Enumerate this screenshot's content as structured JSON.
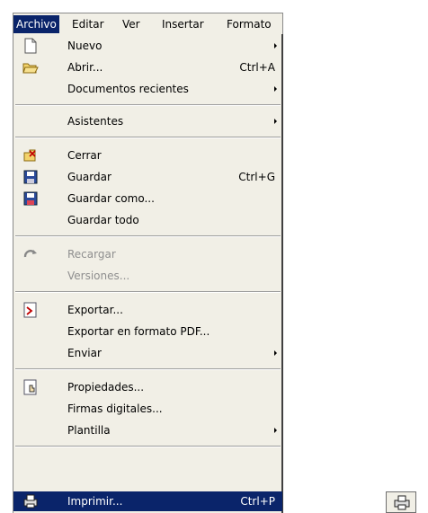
{
  "menubar": {
    "items": [
      {
        "label": "Archivo"
      },
      {
        "label": "Editar"
      },
      {
        "label": "Ver"
      },
      {
        "label": "Insertar"
      },
      {
        "label": "Formato"
      }
    ]
  },
  "menu": {
    "items": [
      {
        "label": "Nuevo",
        "icon": "new-document-icon"
      },
      {
        "label": "Abrir...",
        "shortcut": "Ctrl+A",
        "icon": "open-folder-icon"
      },
      {
        "label": "Documentos recientes"
      },
      {
        "label": "Asistentes"
      },
      {
        "label": "Cerrar",
        "icon": "close-document-icon"
      },
      {
        "label": "Guardar",
        "shortcut": "Ctrl+G",
        "icon": "save-icon"
      },
      {
        "label": "Guardar como...",
        "icon": "save-as-icon"
      },
      {
        "label": "Guardar todo"
      },
      {
        "label": "Recargar",
        "icon": "reload-icon"
      },
      {
        "label": "Versiones..."
      },
      {
        "label": "Exportar...",
        "icon": "export-icon"
      },
      {
        "label": "Exportar en formato PDF..."
      },
      {
        "label": "Enviar"
      },
      {
        "label": "Propiedades...",
        "icon": "properties-icon"
      },
      {
        "label": "Firmas digitales..."
      },
      {
        "label": "Plantilla"
      },
      {
        "label": "Imprimir...",
        "shortcut": "Ctrl+P",
        "icon": "print-icon"
      }
    ]
  },
  "colors": {
    "menu_bg": "#f1efe6",
    "highlight": "#0a246a",
    "disabled_text": "#8f8f8f"
  }
}
